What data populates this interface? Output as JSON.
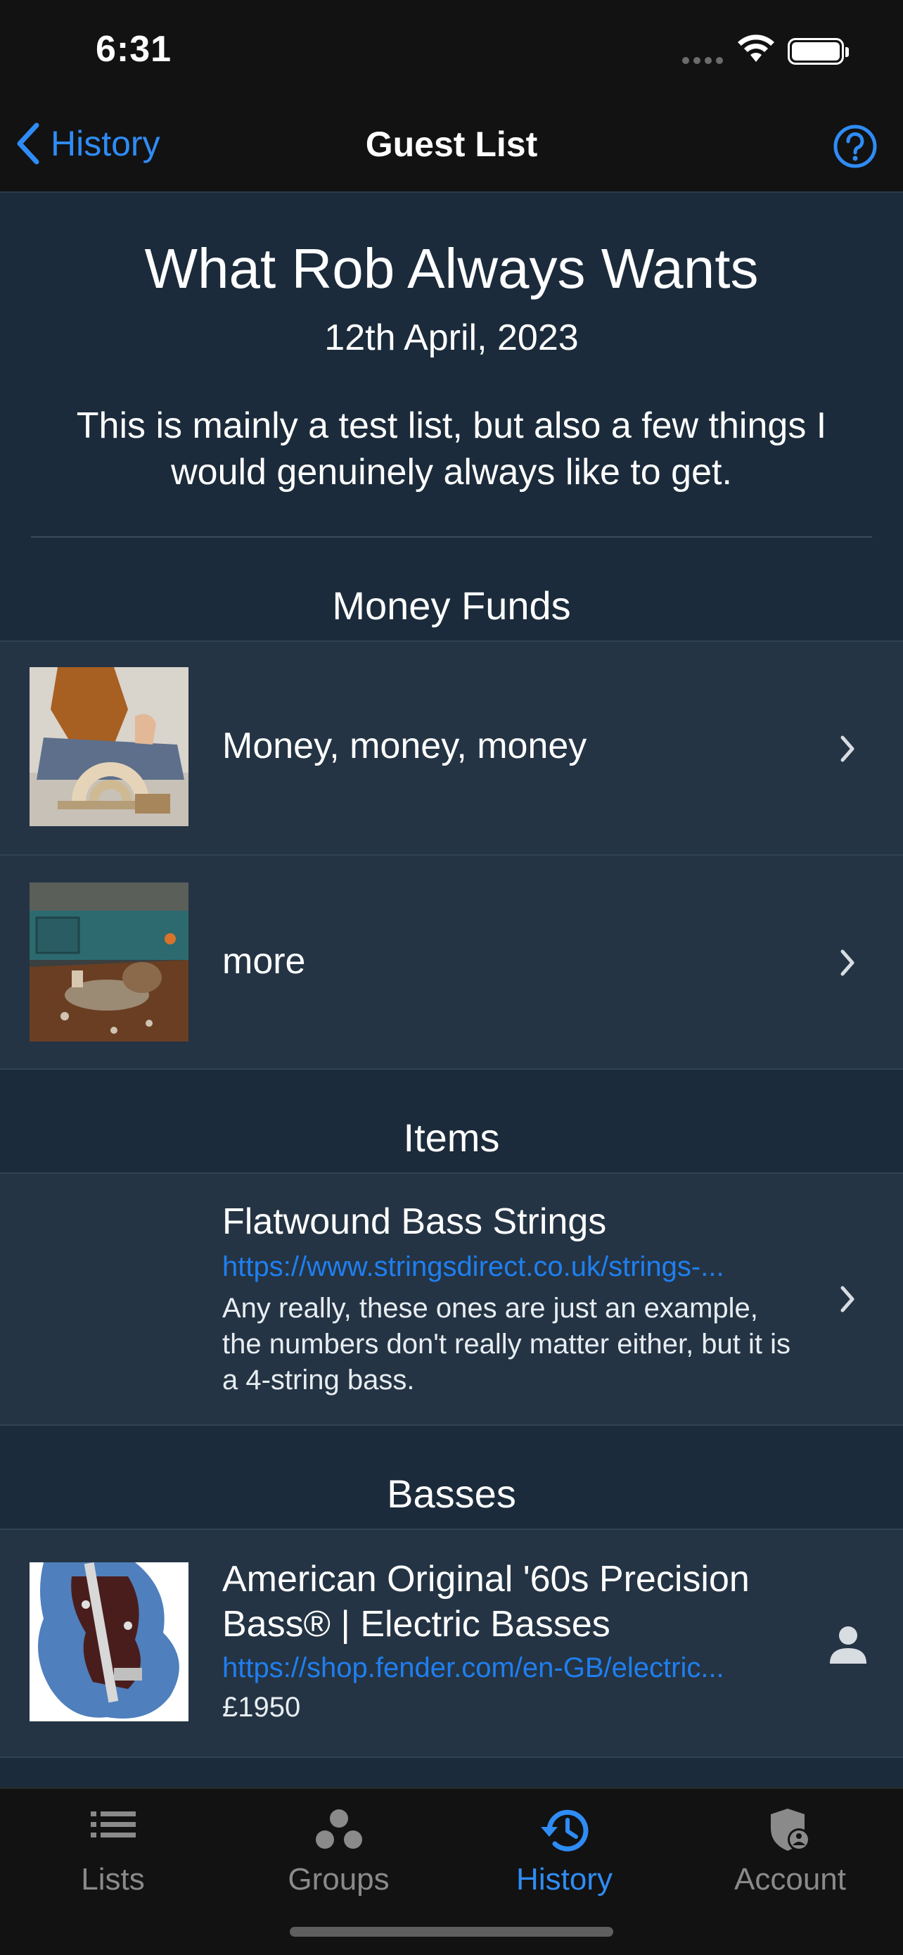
{
  "status_bar": {
    "time": "6:31"
  },
  "nav": {
    "back_label": "History",
    "title": "Guest List",
    "help_icon": "question-circle-icon"
  },
  "header": {
    "title": "What Rob Always Wants",
    "date": "12th April, 2023",
    "description": "This is mainly a test list, but also a few things I would genuinely always like to get."
  },
  "sections": {
    "money_funds": {
      "title": "Money Funds",
      "rows": [
        {
          "label": "Money, money, money"
        },
        {
          "label": "more"
        }
      ]
    },
    "items": {
      "title": "Items",
      "rows": [
        {
          "title": "Flatwound Bass Strings",
          "link": "https://www.stringsdirect.co.uk/strings-...",
          "notes": "Any really, these ones are just an example, the numbers don't really matter either, but it is a 4-string bass."
        }
      ]
    },
    "basses": {
      "title": "Basses",
      "rows": [
        {
          "title": "American Original '60s Precision Bass® | Electric Basses",
          "link": "https://shop.fender.com/en-GB/electric...",
          "price": "£1950"
        }
      ]
    }
  },
  "tab_bar": {
    "tabs": [
      {
        "label": "Lists",
        "icon": "list-icon",
        "active": false
      },
      {
        "label": "Groups",
        "icon": "groups-icon",
        "active": false
      },
      {
        "label": "History",
        "icon": "history-icon",
        "active": true
      },
      {
        "label": "Account",
        "icon": "shield-user-icon",
        "active": false
      }
    ]
  },
  "colors": {
    "accent": "#2f8cf5",
    "background": "#1b2b3b",
    "row_background": "#243444",
    "bar_background": "#121212",
    "link": "#1f7ff0"
  }
}
